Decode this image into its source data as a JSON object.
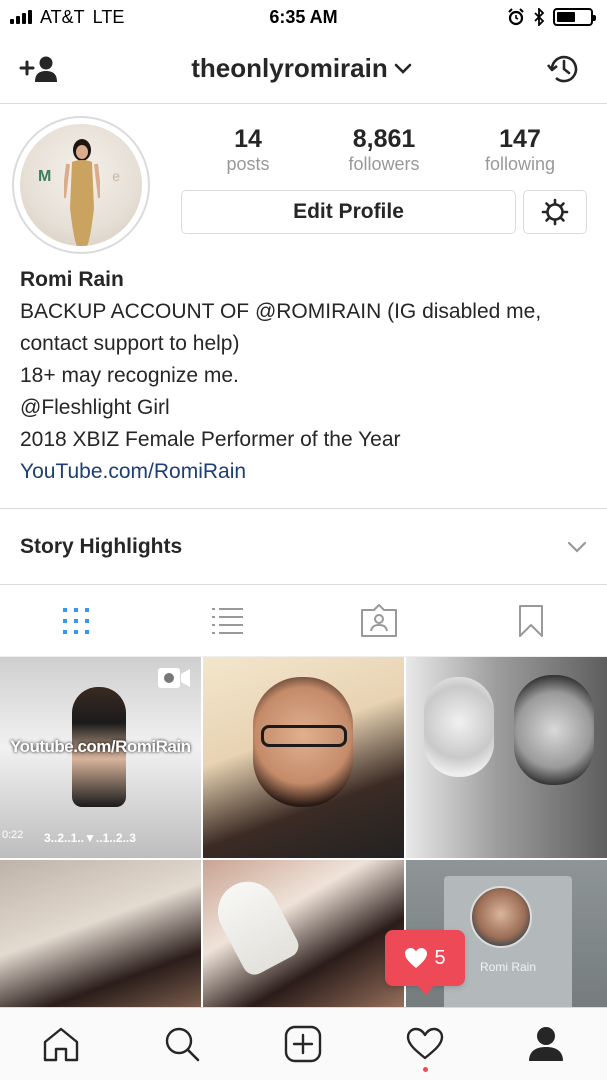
{
  "status_bar": {
    "carrier": "AT&T",
    "network": "LTE",
    "time": "6:35 AM",
    "battery_level": 0.55
  },
  "top_nav": {
    "username": "theonlyromirain",
    "add_user_icon": "add-person-icon",
    "archive_icon": "history-icon"
  },
  "profile": {
    "stats": [
      {
        "value": "14",
        "label": "posts"
      },
      {
        "value": "8,861",
        "label": "followers"
      },
      {
        "value": "147",
        "label": "following"
      }
    ],
    "avatar_letter_left": "M",
    "avatar_letter_right": "e",
    "edit_profile_label": "Edit Profile"
  },
  "bio": {
    "name": "Romi Rain",
    "lines": [
      "BACKUP ACCOUNT OF @ROMIRAIN (IG disabled me, contact support to help)",
      "18+ may recognize me.",
      "@Fleshlight Girl",
      "2018 XBIZ Female Performer of the Year"
    ],
    "link": "YouTube.com/RomiRain"
  },
  "highlights": {
    "title": "Story Highlights"
  },
  "tabs": [
    {
      "name": "grid-view",
      "active": true
    },
    {
      "name": "list-view",
      "active": false
    },
    {
      "name": "tagged-view",
      "active": false
    },
    {
      "name": "saved-view",
      "active": false
    }
  ],
  "grid": {
    "tile1": {
      "overlay_text": "Youtube.com/RomiRain",
      "duration": "0:22",
      "countdown": "3..2..1..▼..1..2..3"
    },
    "tile6": {
      "card_name": "Romi Rain"
    }
  },
  "notification": {
    "likes_count": "5"
  },
  "colors": {
    "accent_blue": "#3897f0",
    "link_blue": "#1e3f73",
    "notification_red": "#ed4956",
    "border_gray": "#dbdbdb",
    "text_dark": "#262626",
    "text_muted": "#999999"
  }
}
